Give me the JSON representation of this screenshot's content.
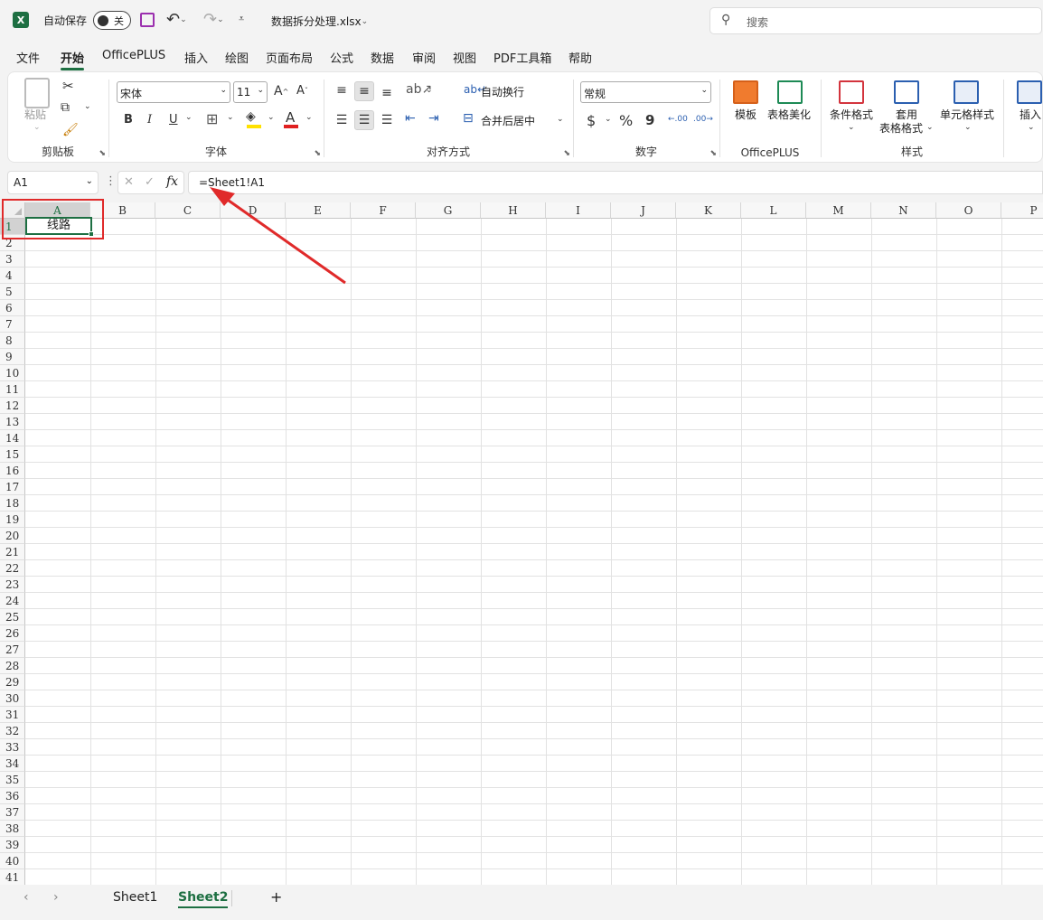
{
  "titlebar": {
    "app_logo": "X",
    "autosave_label": "自动保存",
    "autosave_state": "关",
    "filename": "数据拆分处理.xlsx",
    "search_placeholder": "搜索",
    "icons": [
      "excel-logo-icon",
      "save-icon",
      "undo-icon",
      "redo-icon",
      "customize-qat-icon",
      "search-icon"
    ]
  },
  "menu": {
    "tabs": [
      "文件",
      "开始",
      "OfficePLUS",
      "插入",
      "绘图",
      "页面布局",
      "公式",
      "数据",
      "审阅",
      "视图",
      "PDF工具箱",
      "帮助"
    ],
    "active": "开始"
  },
  "ribbon": {
    "clipboard": {
      "paste_label": "粘贴",
      "group_label": "剪贴板"
    },
    "font": {
      "font_name": "宋体",
      "font_size": "11",
      "bold": "B",
      "italic": "I",
      "underline": "U",
      "group_label": "字体",
      "grow": "A",
      "shrink": "A",
      "font_color_letter": "A"
    },
    "alignment": {
      "wrap_label": "自动换行",
      "merge_label": "合并后居中",
      "group_label": "对齐方式"
    },
    "number": {
      "format": "常规",
      "currency": "$",
      "percent": "%",
      "comma": "9",
      "inc_decimal": ".00",
      "dec_decimal": ".00",
      "group_label": "数字"
    },
    "officeplus": {
      "template_label": "模板",
      "beautify_label": "表格美化",
      "group_label": "OfficePLUS"
    },
    "styles": {
      "conditional_label": "条件格式",
      "table_label_1": "套用",
      "table_label_2": "表格格式",
      "cell_styles_label": "单元格样式",
      "group_label": "样式"
    },
    "cells": {
      "insert_label": "插入"
    },
    "colors": {
      "highlight": "#ffe100",
      "font_color": "#e02020",
      "accent": "#1d6f42"
    }
  },
  "formula_bar": {
    "name_box": "A1",
    "cancel": "✕",
    "enter": "✓",
    "fx": "fx",
    "formula": "=Sheet1!A1"
  },
  "grid": {
    "columns": [
      "A",
      "B",
      "C",
      "D",
      "E",
      "F",
      "G",
      "H",
      "I",
      "J",
      "K",
      "L",
      "M",
      "N",
      "O",
      "P"
    ],
    "rows": [
      "1",
      "2",
      "3",
      "4",
      "5",
      "6",
      "7",
      "8",
      "9",
      "10",
      "11",
      "12",
      "13",
      "14",
      "15",
      "16",
      "17",
      "18",
      "19",
      "20",
      "21",
      "22",
      "23",
      "24",
      "25",
      "26",
      "27",
      "28",
      "29",
      "30",
      "31",
      "32",
      "33",
      "34",
      "35",
      "36",
      "37",
      "38",
      "39",
      "40",
      "41"
    ],
    "selected_column": "A",
    "selected_row": "1",
    "cell_a1": "线路",
    "annotation_color": "#e02a2a"
  },
  "sheets": {
    "tabs": [
      "Sheet1",
      "Sheet2"
    ],
    "active": "Sheet2",
    "add": "+",
    "prev": "‹",
    "next": "›"
  }
}
